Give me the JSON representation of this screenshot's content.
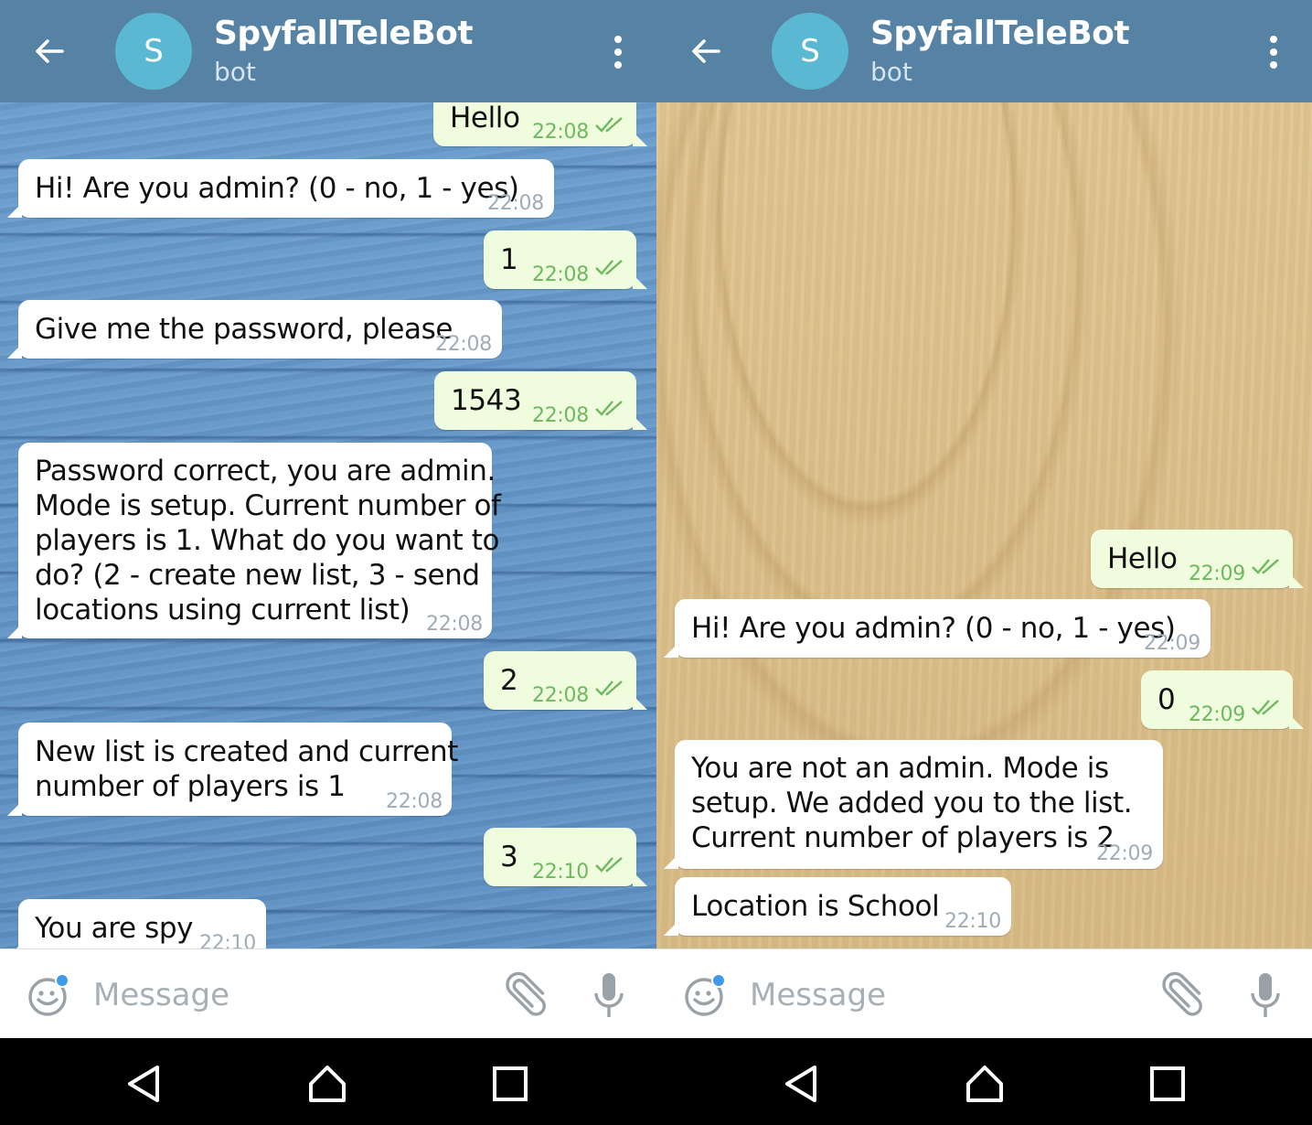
{
  "left_screen": {
    "header": {
      "avatar_letter": "S",
      "title": "SpyfallTeleBot",
      "subtitle": "bot"
    },
    "messages": [
      {
        "dir": "out",
        "text": "Hello",
        "time": "22:08"
      },
      {
        "dir": "in",
        "text": "Hi! Are you admin? (0 - no, 1 - yes)",
        "time": "22:08"
      },
      {
        "dir": "out",
        "text": "1",
        "time": "22:08"
      },
      {
        "dir": "in",
        "text": "Give me the password, please",
        "time": "22:08"
      },
      {
        "dir": "out",
        "text": "1543",
        "time": "22:08"
      },
      {
        "dir": "in",
        "text": "Password correct, you are admin.\nMode is setup. Current number of\nplayers is 1. What do you want to\ndo? (2 - create new list, 3 - send\nlocations using current list)",
        "time": "22:08"
      },
      {
        "dir": "out",
        "text": "2",
        "time": "22:08"
      },
      {
        "dir": "in",
        "text": "New list is created and current\nnumber of players is 1",
        "time": "22:08"
      },
      {
        "dir": "out",
        "text": "3",
        "time": "22:10"
      },
      {
        "dir": "in",
        "text": "You are spy",
        "time": "22:10"
      }
    ],
    "input": {
      "placeholder": "Message",
      "value": ""
    }
  },
  "right_screen": {
    "header": {
      "avatar_letter": "S",
      "title": "SpyfallTeleBot",
      "subtitle": "bot"
    },
    "messages": [
      {
        "dir": "out",
        "text": "Hello",
        "time": "22:09"
      },
      {
        "dir": "in",
        "text": "Hi! Are you admin? (0 - no, 1 - yes)",
        "time": "22:09"
      },
      {
        "dir": "out",
        "text": "0",
        "time": "22:09"
      },
      {
        "dir": "in",
        "text": "You are not an admin. Mode is\nsetup. We added you to the list.\nCurrent number of players is 2",
        "time": "22:09"
      },
      {
        "dir": "in",
        "text": "Location is School",
        "time": "22:10"
      }
    ],
    "input": {
      "placeholder": "Message",
      "value": ""
    }
  },
  "icons": {
    "back": "arrow-back-icon",
    "menu": "more-vertical-icon",
    "emoji": "smiley-icon",
    "attach": "paperclip-icon",
    "mic": "microphone-icon",
    "nav_back": "triangle-back-icon",
    "nav_home": "house-icon",
    "nav_recents": "square-icon"
  },
  "colors": {
    "header": "#5682a3",
    "avatar": "#5ab8d3",
    "outgoing_bubble": "#effdde",
    "incoming_bubble": "#ffffff",
    "read_check": "#6fb85e",
    "unread_dot": "#3d9be9"
  }
}
